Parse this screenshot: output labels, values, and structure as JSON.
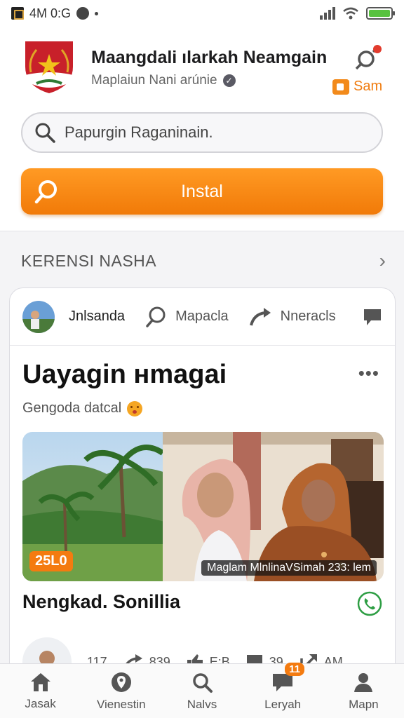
{
  "status_bar": {
    "time": "4M 0:G"
  },
  "header": {
    "app_name": "Maangdali ılarkah Neamgain",
    "publisher": "Maplaiun Nani arúnie",
    "sam_label": "Sam",
    "search_placeholder": "Papurgin Raganinain.",
    "install_label": "Instal"
  },
  "section": {
    "title": "KERENSI NASHA"
  },
  "card": {
    "author": "Jnlsanda",
    "action_search_label": "Mapacla",
    "action_share_label": "Nneracls",
    "post_title": "Uayagin нmagai",
    "post_subtitle": "Gengoda datcal",
    "photo_tag": "25L0",
    "photo_caption": "Maglam MlnlinaVSimah 233: lem",
    "place_name": "Nengkad. Sonillia",
    "stats": {
      "likes": "117",
      "shares": "839",
      "reactions": "E:B",
      "comments": "39",
      "forward": "AM"
    }
  },
  "bottom_nav": [
    {
      "label": "Jasak",
      "icon": "home-icon"
    },
    {
      "label": "Vienestin",
      "icon": "location-pin-icon"
    },
    {
      "label": "Nalvs",
      "icon": "search-icon"
    },
    {
      "label": "Leryah",
      "icon": "chat-icon",
      "badge": "11"
    },
    {
      "label": "Mapn",
      "icon": "profile-icon"
    }
  ],
  "colors": {
    "accent": "#f47b10",
    "install_button": "#ff9a24",
    "call_green": "#2e9e44"
  }
}
